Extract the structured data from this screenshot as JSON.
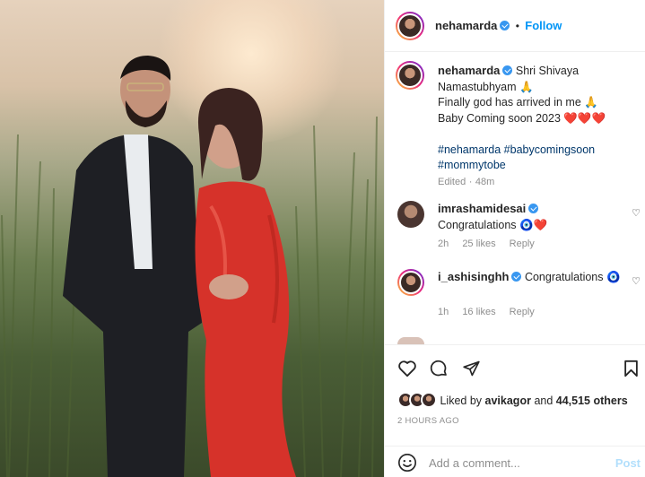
{
  "post": {
    "username": "nehamarda",
    "follow_label": "Follow",
    "separator": "•"
  },
  "caption": {
    "username": "nehamarda",
    "line1": "Shri Shivaya Namastubhyam 🙏",
    "line2": "Finally god has arrived in me 🙏",
    "line3": "Baby Coming soon 2023 ❤️❤️❤️",
    "hashtags": "#nehamarda #babycomingsoon #mommytobe",
    "edited": "Edited",
    "dot": "·",
    "age": "48m"
  },
  "comments": [
    {
      "username": "imrashamidesai",
      "text": "Congratulations 🧿❤️",
      "age": "2h",
      "likes": "25 likes",
      "reply": "Reply"
    },
    {
      "username": "i_ashisinghh",
      "text": "Congratulations 🧿",
      "age": "1h",
      "likes": "16 likes",
      "reply": "Reply"
    }
  ],
  "likes": {
    "prefix": "Liked by",
    "user": "avikagor",
    "and": "and",
    "others": "44,515 others"
  },
  "timestamp": "2 HOURS AGO",
  "add_comment": {
    "placeholder": "Add a comment...",
    "post_label": "Post"
  },
  "colors": {
    "accent": "#0095f6",
    "verified": "#3897f0",
    "muted": "#8e8e8e",
    "hashtag": "#00376b"
  },
  "icons": [
    "verified-badge-icon",
    "heart-icon",
    "comment-icon",
    "share-icon",
    "bookmark-icon",
    "emoji-icon",
    "more-icon"
  ]
}
